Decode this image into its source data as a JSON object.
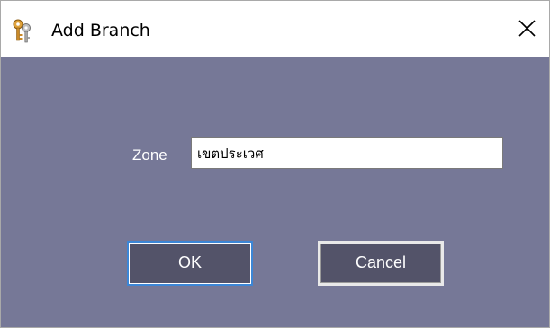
{
  "window": {
    "title": "Add Branch",
    "title_icon": "keys-icon",
    "close_icon": "close-icon"
  },
  "form": {
    "zone_label": "Zone",
    "zone_value": "เขตประเวศ"
  },
  "buttons": {
    "ok_label": "OK",
    "cancel_label": "Cancel"
  },
  "colors": {
    "background": "#767897",
    "button": "#535369",
    "focus_border": "#3c86d6"
  }
}
